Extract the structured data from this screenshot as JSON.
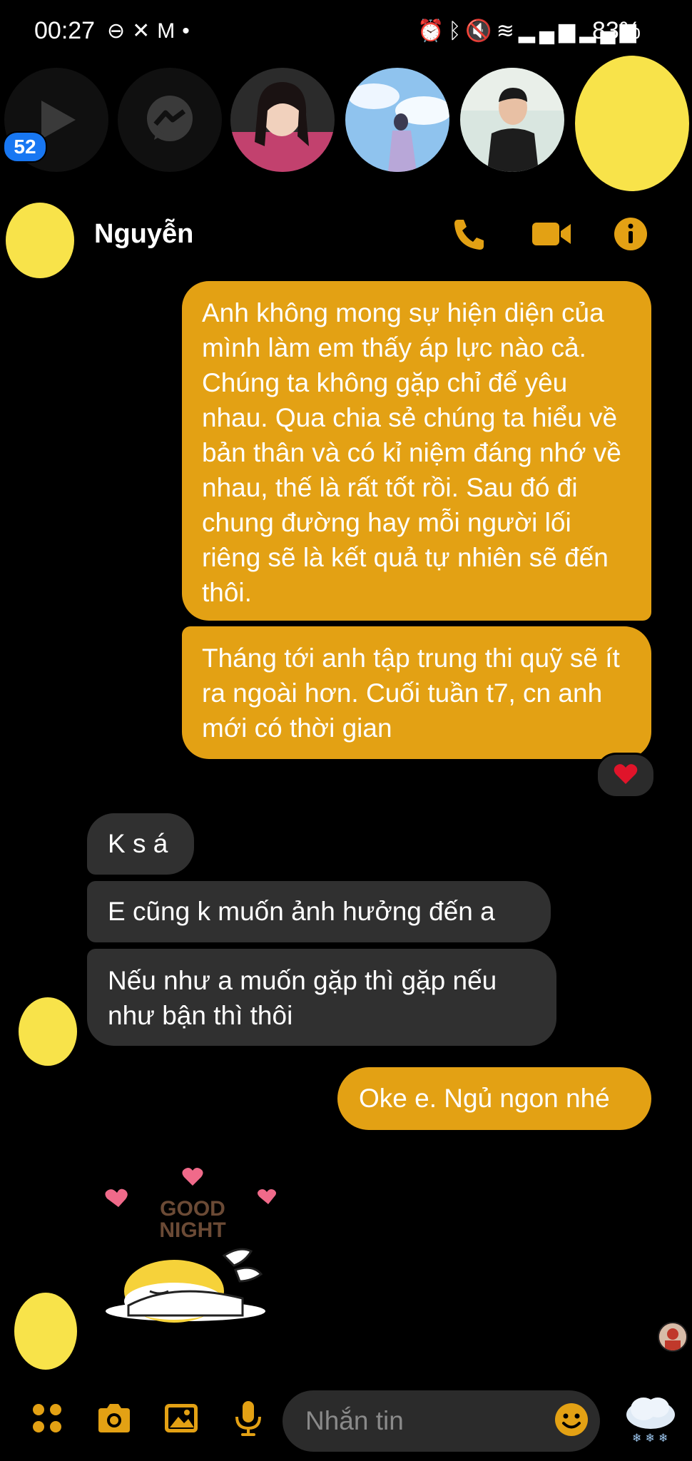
{
  "status_bar": {
    "time": "00:27",
    "left_icons": [
      "do-not-disturb-icon",
      "missed-call-icon",
      "gmail-icon",
      "dot-icon"
    ],
    "right_icons": [
      "alarm-icon",
      "bluetooth-icon",
      "mute-icon",
      "wifi-icon",
      "signal-icon",
      "signal-icon"
    ],
    "battery": "83%"
  },
  "stories": {
    "badge_count": "52",
    "items": [
      "play-button",
      "messenger-button",
      "story-avatar-1",
      "story-avatar-2",
      "story-avatar-3",
      "story-avatar-4"
    ]
  },
  "header": {
    "contact_name": "Nguyễn",
    "actions": [
      "phone-icon",
      "video-icon",
      "info-icon"
    ]
  },
  "messages": [
    {
      "direction": "out",
      "text": "Anh không mong sự hiện diện của mình làm em thấy áp lực nào cả. Chúng ta không gặp chỉ để yêu nhau. Qua chia sẻ chúng ta hiểu về bản thân và có kỉ niệm đáng nhớ về nhau, thế là rất tốt rồi. Sau đó đi chung đường hay mỗi người lối riêng sẽ là kết quả tự nhiên sẽ đến thôi."
    },
    {
      "direction": "out",
      "text": "Tháng tới anh tập trung thi quỹ sẽ ít ra ngoài hơn. Cuối tuần t7, cn anh mới có thời gian",
      "reaction": "heart"
    },
    {
      "direction": "in",
      "text": "K s á"
    },
    {
      "direction": "in",
      "text": "E cũng k muốn ảnh hưởng đến a"
    },
    {
      "direction": "in",
      "text": "Nếu như a muốn gặp thì gặp nếu như bận thì thôi"
    },
    {
      "direction": "out",
      "text": "Oke e. Ngủ ngon nhé"
    }
  ],
  "sticker": {
    "line1": "GOOD",
    "line2": "NIGHT"
  },
  "composer": {
    "placeholder": "Nhắn tin",
    "icons": [
      "apps-icon",
      "camera-icon",
      "gallery-icon",
      "mic-icon",
      "emoji-icon",
      "weather-sticker-icon"
    ]
  },
  "colors": {
    "accent": "#e3a114",
    "incoming_bubble": "#303030",
    "badge": "#1877f2",
    "redaction": "#f8e34a"
  }
}
